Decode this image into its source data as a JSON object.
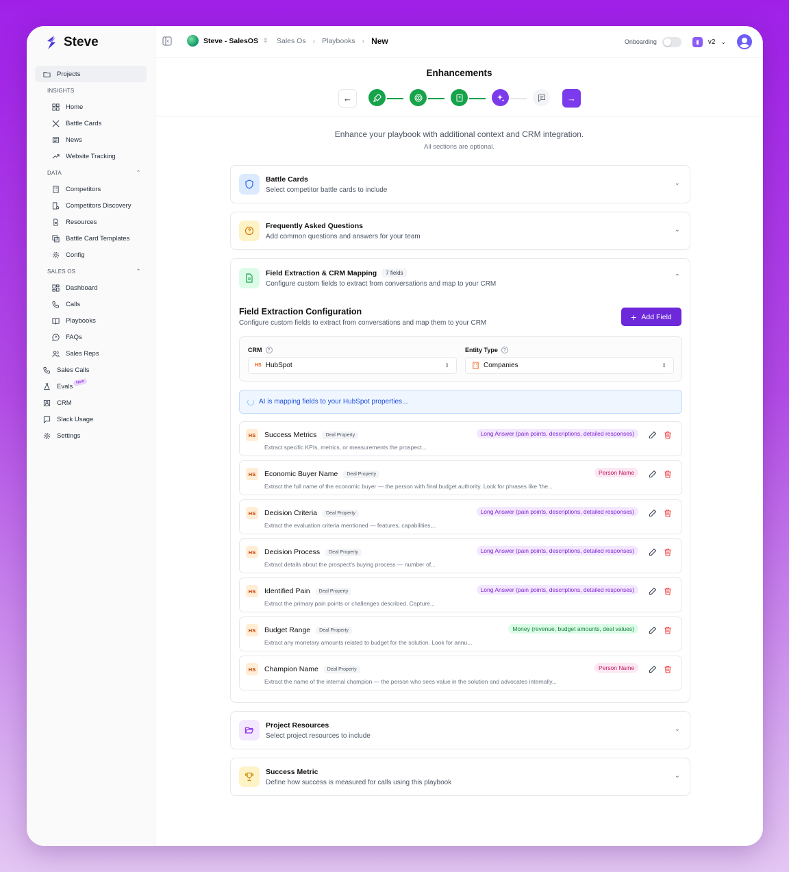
{
  "app": {
    "name": "Steve"
  },
  "sidebar": {
    "projects": "Projects",
    "insights_label": "INSIGHTS",
    "insights": [
      "Home",
      "Battle Cards",
      "News",
      "Website Tracking"
    ],
    "data_label": "DATA",
    "data": [
      "Competitors",
      "Competitors Discovery",
      "Resources",
      "Battle Card Templates",
      "Config"
    ],
    "salesos_label": "SALES OS",
    "salesos": [
      "Dashboard",
      "Calls",
      "Playbooks",
      "FAQs",
      "Sales Reps"
    ],
    "bottom": [
      "Sales Calls",
      "Evals",
      "CRM",
      "Slack Usage",
      "Settings"
    ],
    "new_badge": "New"
  },
  "header": {
    "workspace": "Steve - SalesOS",
    "crumb1": "Sales Os",
    "crumb2": "Playbooks",
    "crumb3": "New",
    "onboarding": "Onboarding",
    "version": "v2"
  },
  "page": {
    "title": "Enhancements",
    "intro": "Enhance your playbook with additional context and CRM integration.",
    "intro_sub": "All sections are optional."
  },
  "sections": {
    "battle": {
      "title": "Battle Cards",
      "sub": "Select competitor battle cards to include"
    },
    "faq": {
      "title": "Frequently Asked Questions",
      "sub": "Add common questions and answers for your team"
    },
    "fe": {
      "title": "Field Extraction & CRM Mapping",
      "badge": "7 fields",
      "sub": "Configure custom fields to extract from conversations and map to your CRM"
    },
    "resources": {
      "title": "Project Resources",
      "sub": "Select project resources to include"
    },
    "metric": {
      "title": "Success Metric",
      "sub": "Define how success is measured for calls using this playbook"
    }
  },
  "config": {
    "title": "Field Extraction Configuration",
    "sub": "Configure custom fields to extract from conversations and map them to your CRM",
    "add_button": "Add Field",
    "crm_label": "CRM",
    "crm_value": "HubSpot",
    "entity_label": "Entity Type",
    "entity_value": "Companies",
    "ai_banner": "AI is mapping fields to your HubSpot properties..."
  },
  "fields": [
    {
      "badge": "HS",
      "name": "Success Metrics",
      "tag": "Deal Property",
      "type": "Long Answer (pain points, descriptions, detailed responses)",
      "color": "purple",
      "desc": "Extract specific KPIs, metrics, or measurements the prospect..."
    },
    {
      "badge": "HS",
      "name": "Economic Buyer Name",
      "tag": "Deal Property",
      "type": "Person Name",
      "color": "pink",
      "desc": "Extract the full name of the economic buyer — the person with final budget authority. Look for phrases like 'the..."
    },
    {
      "badge": "HS",
      "name": "Decision Criteria",
      "tag": "Deal Property",
      "type": "Long Answer (pain points, descriptions, detailed responses)",
      "color": "purple",
      "desc": "Extract the evaluation criteria mentioned — features, capabilities,..."
    },
    {
      "badge": "HS",
      "name": "Decision Process",
      "tag": "Deal Property",
      "type": "Long Answer (pain points, descriptions, detailed responses)",
      "color": "purple",
      "desc": "Extract details about the prospect's buying process — number of..."
    },
    {
      "badge": "HS",
      "name": "Identified Pain",
      "tag": "Deal Property",
      "type": "Long Answer (pain points, descriptions, detailed responses)",
      "color": "purple",
      "desc": "Extract the primary pain points or challenges described. Capture..."
    },
    {
      "badge": "HS",
      "name": "Budget Range",
      "tag": "Deal Property",
      "type": "Money (revenue, budget amounts, deal values)",
      "color": "green",
      "desc": "Extract any monetary amounts related to budget for the solution. Look for annu..."
    },
    {
      "badge": "HS",
      "name": "Champion Name",
      "tag": "Deal Property",
      "type": "Person Name",
      "color": "pink",
      "desc": "Extract the name of the internal champion — the person who sees value in the solution and advocates internally..."
    }
  ]
}
